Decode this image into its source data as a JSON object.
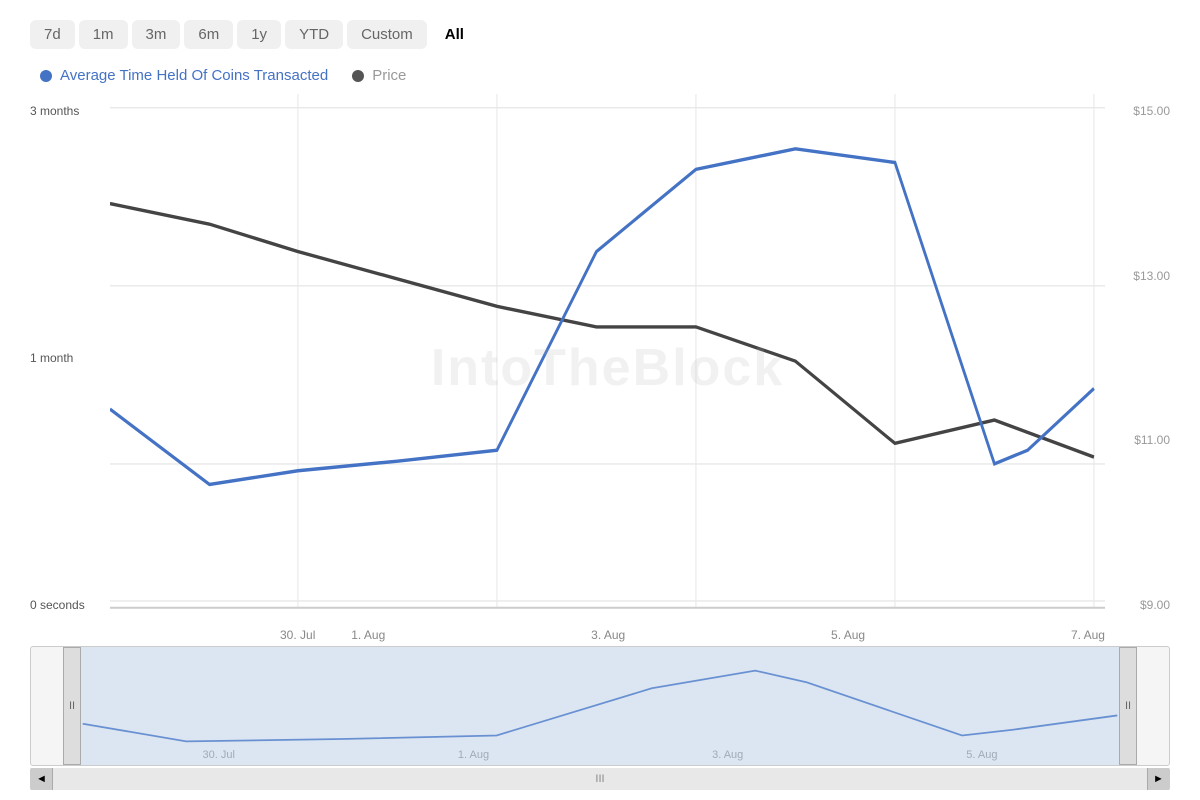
{
  "timeFilters": {
    "buttons": [
      "7d",
      "1m",
      "3m",
      "6m",
      "1y",
      "YTD",
      "Custom",
      "All"
    ],
    "active": "All"
  },
  "legend": {
    "items": [
      {
        "id": "avg-time",
        "label": "Average Time Held Of Coins Transacted",
        "color": "#4472C4",
        "dotColor": "#4472C4"
      },
      {
        "id": "price",
        "label": "Price",
        "color": "#555555",
        "dotColor": "#555555"
      }
    ]
  },
  "yAxisLeft": {
    "labels": [
      "3 months",
      "1 month",
      "0 seconds"
    ]
  },
  "yAxisRight": {
    "labels": [
      "$15.00",
      "$13.00",
      "$11.00",
      "$9.00"
    ]
  },
  "xAxisLabels": [
    "30. Jul",
    "1. Aug",
    "3. Aug",
    "5. Aug",
    "7. Aug"
  ],
  "watermark": "IntoTheBlock",
  "navigator": {
    "xLabels": [
      "30. Jul",
      "1. Aug",
      "3. Aug",
      "5. Aug"
    ],
    "handleLeft": "II",
    "handleRight": "II",
    "scrollThumb": "III"
  },
  "scrollbar": {
    "leftArrow": "◄",
    "rightArrow": "►",
    "thumbLabel": "III"
  }
}
